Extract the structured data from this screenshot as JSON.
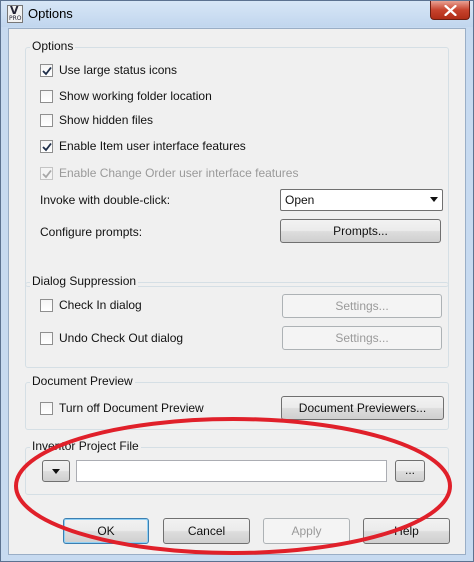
{
  "window": {
    "title": "Options",
    "app_icon": "vault-pro-icon",
    "close_icon": "close-icon"
  },
  "options_group": {
    "title": "Options",
    "items": [
      {
        "label": "Use large status icons",
        "checked": true,
        "enabled": true
      },
      {
        "label": "Show working folder location",
        "checked": false,
        "enabled": true
      },
      {
        "label": "Show hidden files",
        "checked": false,
        "enabled": true
      },
      {
        "label": "Enable Item user interface features",
        "checked": true,
        "enabled": true
      },
      {
        "label": "Enable Change Order user interface features",
        "checked": true,
        "enabled": false
      }
    ],
    "invoke_label": "Invoke with double-click:",
    "invoke_value": "Open",
    "configure_label": "Configure prompts:",
    "prompts_button": "Prompts..."
  },
  "dialog_suppression": {
    "title": "Dialog Suppression",
    "items": [
      {
        "label": "Check In dialog",
        "checked": false,
        "settings_button": "Settings..."
      },
      {
        "label": "Undo Check Out dialog",
        "checked": false,
        "settings_button": "Settings..."
      }
    ]
  },
  "document_preview": {
    "title": "Document Preview",
    "turn_off_label": "Turn off Document Preview",
    "turn_off_checked": false,
    "previewers_button": "Document Previewers..."
  },
  "project_file": {
    "title": "Inventor Project File",
    "path_value": "",
    "browse_button": "..."
  },
  "footer": {
    "ok": "OK",
    "cancel": "Cancel",
    "apply": "Apply",
    "help": "Help"
  },
  "colors": {
    "annotation": "#e0202a",
    "window_frame": "#c7daf0",
    "dialog_bg": "#f0f0f0"
  }
}
